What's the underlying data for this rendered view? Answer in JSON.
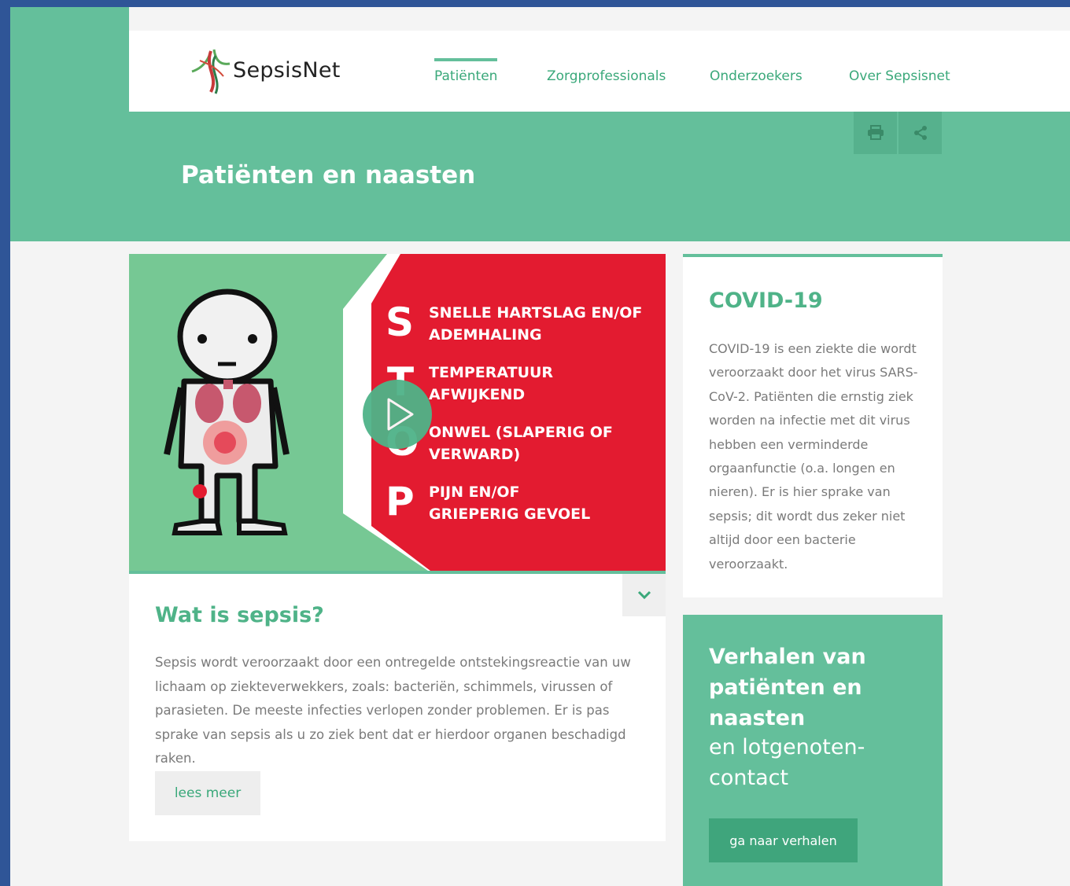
{
  "site": {
    "logo_text": "SepsisNet"
  },
  "nav": {
    "items": [
      {
        "label": "Patiënten",
        "active": true
      },
      {
        "label": "Zorgprofessionals",
        "active": false
      },
      {
        "label": "Onderzoekers",
        "active": false
      },
      {
        "label": "Over Sepsisnet",
        "active": false
      }
    ]
  },
  "banner": {
    "title": "Patiënten en naasten",
    "tools": [
      "print-icon",
      "share-icon"
    ]
  },
  "video": {
    "stop_items": [
      {
        "letter": "S",
        "line1": "SNELLE HARTSLAG EN/OF",
        "line2": "ADEMHALING"
      },
      {
        "letter": "T",
        "line1": "TEMPERATUUR",
        "line2": "AFWIJKEND"
      },
      {
        "letter": "O",
        "line1": "ONWEL (SLAPERIG OF",
        "line2": "VERWARD)"
      },
      {
        "letter": "P",
        "line1": "PIJN EN/OF",
        "line2": "GRIEPERIG GEVOEL"
      }
    ]
  },
  "main_card": {
    "title": "Wat is sepsis?",
    "body": "Sepsis wordt veroorzaakt door een ontregelde ontstekingsreactie van uw lichaam op ziekteverwekkers, zoals: bacteriën, schimmels, virussen of parasieten. De meeste infecties verlopen zonder problemen. Er is pas sprake van sepsis als u zo ziek bent dat er hierdoor organen beschadigd raken.",
    "button": "lees meer"
  },
  "covid_card": {
    "title": "COVID-19",
    "body": "COVID-19 is een ziekte die wordt veroorzaakt door het virus SARS-CoV-2. Patiënten die ernstig ziek worden na infectie met dit virus hebben een verminderde orgaanfunctie (o.a. longen en nieren). Er is hier sprake van sepsis; dit wordt dus zeker niet altijd door een bacterie veroorzaakt."
  },
  "stories_card": {
    "title": "Verhalen van patiënten en naasten",
    "subtitle": "en lotgenoten-contact",
    "button": "ga naar verhalen"
  },
  "colors": {
    "brand_green": "#64bf9b",
    "text_green": "#3aa87a",
    "stop_red": "#e31b30",
    "frame_blue": "#2f5597"
  }
}
